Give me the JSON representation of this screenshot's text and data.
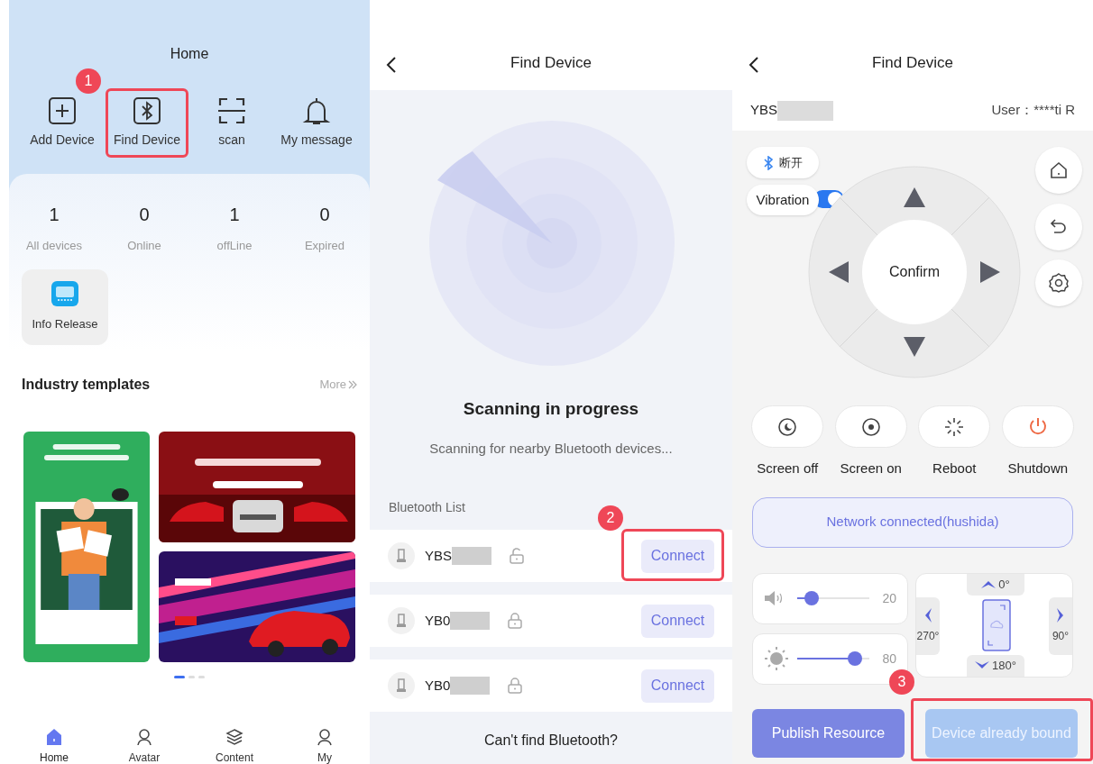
{
  "home": {
    "title": "Home",
    "actions": [
      {
        "label": "Add Device",
        "highlighted": false
      },
      {
        "label": "Find Device",
        "highlighted": true,
        "step": "1"
      },
      {
        "label": "scan",
        "highlighted": false
      },
      {
        "label": "My message",
        "highlighted": false
      }
    ],
    "stats": [
      {
        "value": "1",
        "label": "All devices"
      },
      {
        "value": "0",
        "label": "Online"
      },
      {
        "value": "1",
        "label": "offLine"
      },
      {
        "value": "0",
        "label": "Expired"
      }
    ],
    "apps": [
      {
        "label": "Info Release"
      }
    ],
    "templates_section": {
      "title": "Industry templates",
      "more": "More"
    },
    "carousel_pages": [
      {
        "selected": true
      },
      {
        "selected": false
      },
      {
        "selected": false
      }
    ],
    "nav": [
      {
        "label": "Home",
        "selected": true
      },
      {
        "label": "Avatar",
        "selected": false
      },
      {
        "label": "Content",
        "selected": false
      },
      {
        "label": "My",
        "selected": false
      }
    ]
  },
  "find": {
    "title": "Find Device",
    "status_title": "Scanning in progress",
    "status_text": "Scanning for nearby Bluetooth devices...",
    "list_title": "Bluetooth List",
    "devices": [
      {
        "name": "YBS",
        "locked": false,
        "button": "Connect",
        "highlighted": true,
        "step": "2"
      },
      {
        "name": "YB0",
        "locked": true,
        "button": "Connect",
        "highlighted": false
      },
      {
        "name": "YB0",
        "locked": true,
        "button": "Connect",
        "highlighted": false
      }
    ],
    "help": "Can't find Bluetooth?"
  },
  "control": {
    "title": "Find Device",
    "device": "YBS",
    "user": "User：****ti R",
    "bluetooth_button": "断开",
    "vibration": {
      "label": "Vibration",
      "on": true
    },
    "confirm": "Confirm",
    "functions": [
      {
        "label": "Screen off"
      },
      {
        "label": "Screen on"
      },
      {
        "label": "Reboot"
      },
      {
        "label": "Shutdown"
      }
    ],
    "network": "Network connected(hushida)",
    "sliders": [
      {
        "kind": "volume",
        "level": 0.2,
        "reading": "20"
      },
      {
        "kind": "brightness",
        "level": 0.8,
        "reading": "80"
      }
    ],
    "rotation": [
      {
        "label": "0°"
      },
      {
        "label": "90°"
      },
      {
        "label": "180°"
      },
      {
        "label": "270°"
      }
    ],
    "buttons": [
      {
        "label": "Publish Resource",
        "highlighted": false
      },
      {
        "label": "Device already bound",
        "highlighted": true,
        "step": "3"
      }
    ]
  }
}
